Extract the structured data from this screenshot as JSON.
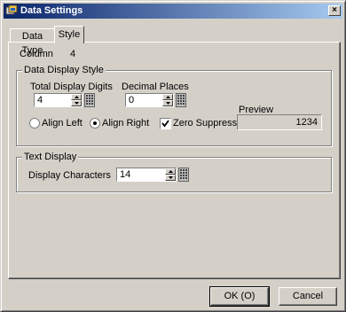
{
  "window": {
    "title": "Data Settings",
    "close_label": "×"
  },
  "tabs": [
    {
      "label": "Data Type"
    },
    {
      "label": "Style"
    }
  ],
  "column": {
    "label": "Column",
    "value": "4"
  },
  "data_display_style": {
    "title": "Data Display Style",
    "total_digits": {
      "label": "Total Display Digits",
      "value": "4"
    },
    "decimal_places": {
      "label": "Decimal Places",
      "value": "0"
    },
    "align_left_label": "Align Left",
    "align_right_label": "Align Right",
    "zero_suppress_label": "Zero Suppress",
    "zero_suppress_checked": true,
    "alignment_selected": "Align Right",
    "preview_label": "Preview",
    "preview_value": "1234"
  },
  "text_display": {
    "title": "Text Display",
    "display_characters": {
      "label": "Display Characters",
      "value": "14"
    }
  },
  "footer": {
    "ok_label": "OK (O)",
    "cancel_label": "Cancel"
  }
}
